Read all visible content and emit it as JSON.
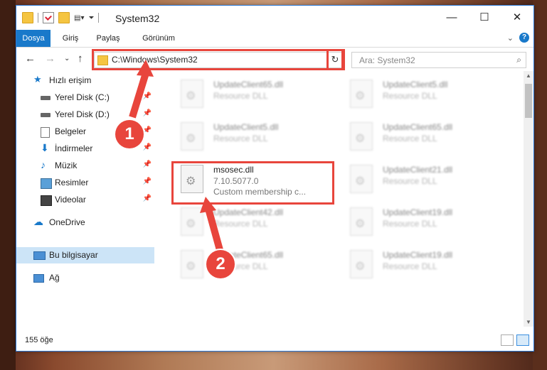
{
  "window": {
    "title": "System32",
    "minimize": "—",
    "maximize": "☐",
    "close": "✕"
  },
  "ribbon": {
    "tabs": [
      "Dosya",
      "Giriş",
      "Paylaş",
      "Görünüm"
    ],
    "help": "?",
    "expand": "⌄"
  },
  "nav": {
    "back": "←",
    "forward": "→",
    "recent": "⌄",
    "up": "↑"
  },
  "address": {
    "path": "C:\\Windows\\System32",
    "refresh": "↻",
    "dropdown": "⌄"
  },
  "search": {
    "placeholder": "Ara: System32",
    "icon": "search-icon"
  },
  "sidebar": {
    "items": [
      {
        "label": "Hızlı erişim",
        "icon": "star-icon"
      },
      {
        "label": "Yerel Disk (C:)",
        "icon": "drive-icon",
        "pinned": true
      },
      {
        "label": "Yerel Disk (D:)",
        "icon": "drive-icon",
        "pinned": true
      },
      {
        "label": "Belgeler",
        "icon": "documents-icon",
        "pinned": true
      },
      {
        "label": "İndirmeler",
        "icon": "download-icon",
        "pinned": true
      },
      {
        "label": "Müzik",
        "icon": "music-icon",
        "pinned": true
      },
      {
        "label": "Resimler",
        "icon": "pictures-icon",
        "pinned": true
      },
      {
        "label": "Videolar",
        "icon": "videos-icon",
        "pinned": true
      },
      {
        "label": "OneDrive",
        "icon": "cloud-icon"
      },
      {
        "label": "Bu bilgisayar",
        "icon": "computer-icon",
        "selected": true
      },
      {
        "label": "Ağ",
        "icon": "network-icon"
      }
    ]
  },
  "files": [
    {
      "name": "UpdateClient65.dll",
      "type": "Resource DLL"
    },
    {
      "name": "UpdateClient5.dll",
      "type": "Resource DLL"
    },
    {
      "name": "UpdateClient5.dll",
      "type": "Resource DLL"
    },
    {
      "name": "UpdateClient65.dll",
      "type": "Resource DLL"
    },
    {
      "name": "msosec.dll",
      "version": "7.10.5077.0",
      "description": "Custom membership c..."
    },
    {
      "name": "UpdateClient21.dll",
      "type": "Resource DLL"
    },
    {
      "name": "UpdateClient42.dll",
      "type": "Resource DLL"
    },
    {
      "name": "UpdateClient19.dll",
      "type": "Resource DLL"
    },
    {
      "name": "UpdateClient65.dll",
      "type": "Resource DLL"
    },
    {
      "name": "UpdateClient19.dll",
      "type": "Resource DLL"
    }
  ],
  "status": {
    "count": "155 öğe"
  },
  "annotations": {
    "badge1": "1",
    "badge2": "2",
    "color": "#e8453c"
  }
}
